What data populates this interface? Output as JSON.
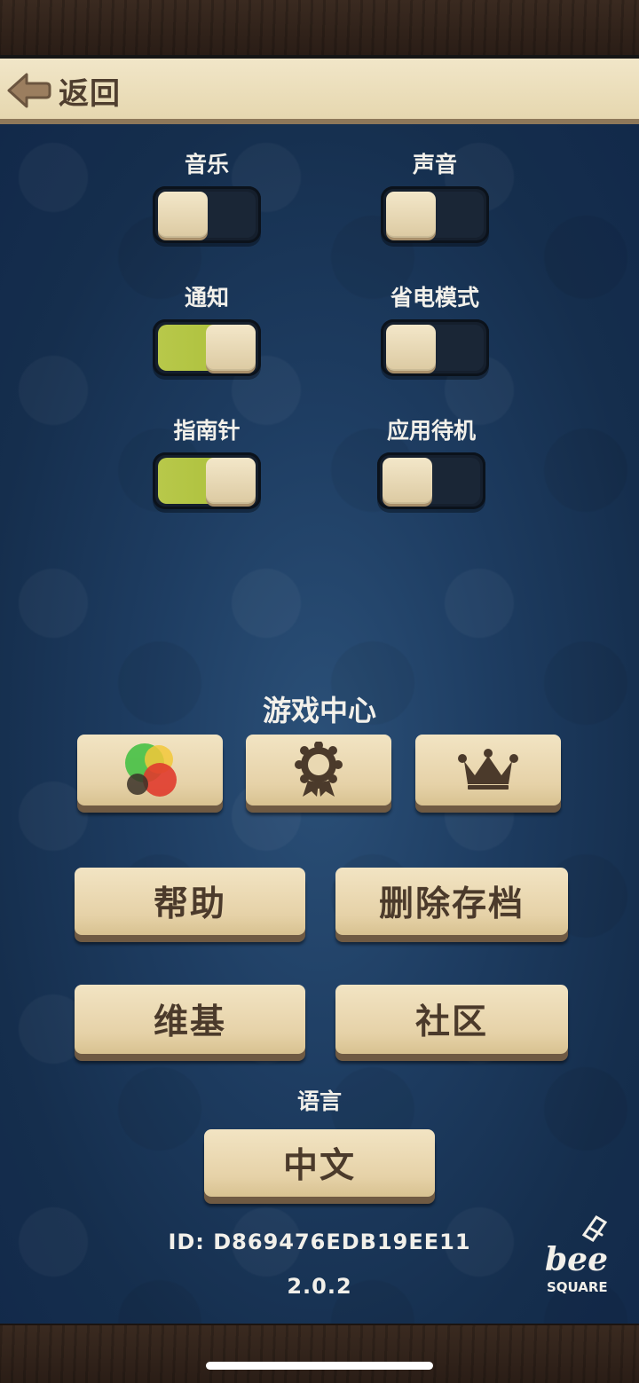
{
  "header": {
    "back_label": "返回"
  },
  "toggles": [
    {
      "label": "音乐",
      "state": "off"
    },
    {
      "label": "声音",
      "state": "off"
    },
    {
      "label": "通知",
      "state": "on"
    },
    {
      "label": "省电模式",
      "state": "off"
    },
    {
      "label": "指南针",
      "state": "on"
    },
    {
      "label": "应用待机",
      "state": "off"
    }
  ],
  "game_center": {
    "title": "游戏中心",
    "icons": [
      "game-center-icon",
      "achievement-icon",
      "leaderboard-crown-icon"
    ]
  },
  "buttons": {
    "help": "帮助",
    "delete_save": "删除存档",
    "wiki": "维基",
    "community": "社区"
  },
  "language": {
    "label": "语言",
    "value": "中文"
  },
  "footer": {
    "id": "ID: D869476EDB19EE11",
    "version": "2.0.2"
  },
  "logo": {
    "text_top": "bee",
    "text_bottom": "SQUARE"
  },
  "colors": {
    "toggle_on": "#b8c84a",
    "button": "#efe0bd",
    "button_text": "#4b3a2b",
    "background": "#1e3d62"
  }
}
